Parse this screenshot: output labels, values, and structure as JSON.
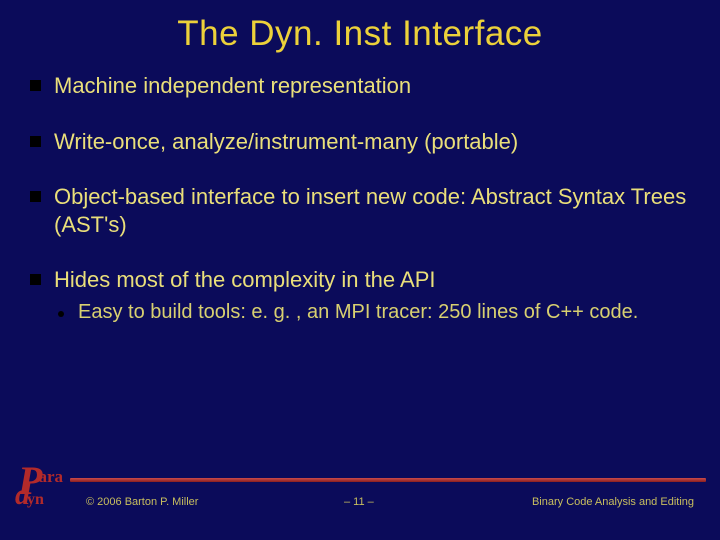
{
  "title": "The Dyn. Inst Interface",
  "bullets": [
    {
      "text": "Machine independent representation"
    },
    {
      "text": "Write-once, analyze/instrument-many (portable)"
    },
    {
      "text": "Object-based interface to insert new code: Abstract Syntax Trees (AST's)"
    },
    {
      "text": "Hides most of the complexity in the API",
      "sub": [
        "Easy to build tools: e. g. , an MPI tracer: 250 lines of C++ code."
      ]
    }
  ],
  "logo": {
    "p": "P",
    "ara": "ara",
    "d": "d",
    "yn": "yn"
  },
  "footer": {
    "copyright": "© 2006 Barton P. Miller",
    "pagenum": "– 11 –",
    "subtitle": "Binary Code Analysis and Editing"
  }
}
